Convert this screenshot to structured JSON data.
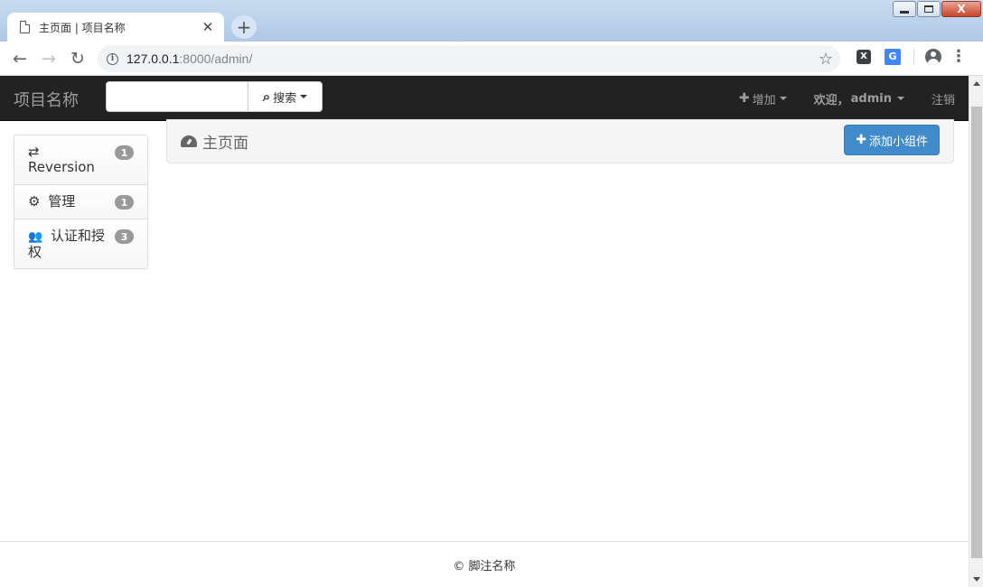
{
  "browser": {
    "tab_title": "主页面 | 项目名称",
    "tab_close": "✕",
    "new_tab": "+",
    "url_host": "127.0.0.1",
    "url_path": ":8000/admin/",
    "info_glyph": "i",
    "back_glyph": "←",
    "forward_glyph": "→",
    "reload_glyph": "↻",
    "star_glyph": "☆",
    "ext_x_label": "X",
    "ext_translate_label": "G",
    "menu_glyph": "⋮",
    "win_close_glyph": "X"
  },
  "navbar": {
    "brand": "项目名称",
    "search_value": "",
    "search_button": "搜索",
    "search_glyph": "⌕",
    "add_label": "增加",
    "welcome_prefix": "欢迎，",
    "username": "admin",
    "logout": "注销"
  },
  "sidebar": {
    "items": [
      {
        "icon": "exchange-icon",
        "glyph": "⇄",
        "label": "Reversion",
        "badge": "1"
      },
      {
        "icon": "cog-icon",
        "glyph": "⚙",
        "label": "管理",
        "badge": "1"
      },
      {
        "icon": "users-icon",
        "glyph": "👥",
        "label": "认证和授权",
        "badge": "3"
      }
    ]
  },
  "main": {
    "title": "主页面",
    "title_icon": "dashboard-icon",
    "add_widget_label": "添加小组件"
  },
  "footer": {
    "copyright": "© 脚注名称"
  },
  "colors": {
    "navbar_bg": "#222222",
    "navbar_text": "#9d9d9d",
    "primary_button": "#428bca",
    "badge": "#999999"
  }
}
